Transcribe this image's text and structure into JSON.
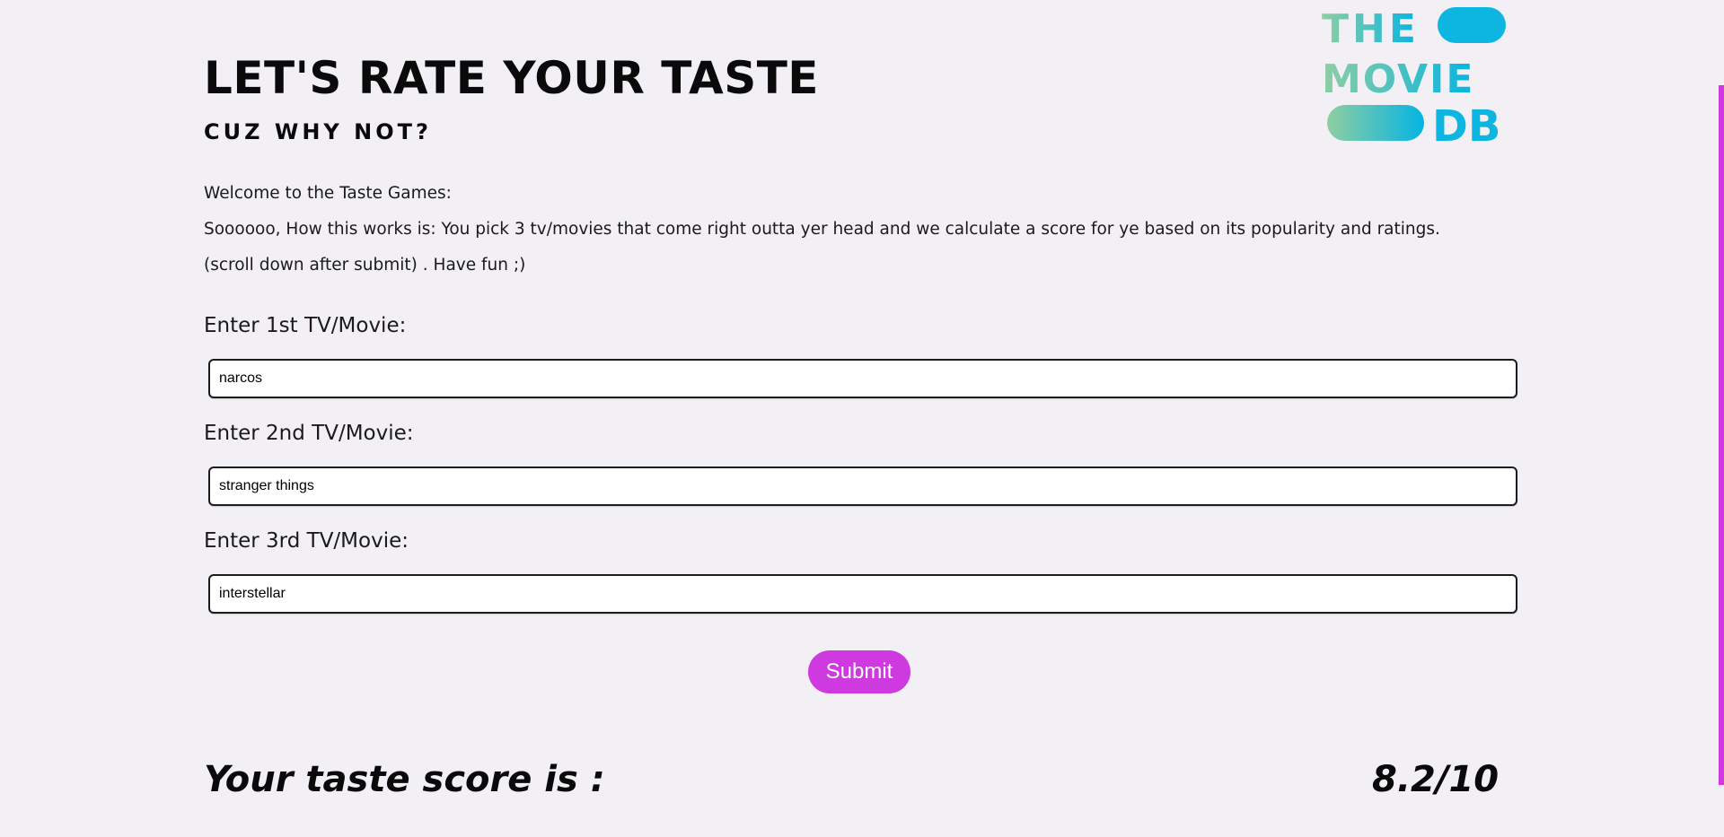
{
  "header": {
    "title": "LET'S RATE YOUR TASTE",
    "subtitle": "CUZ WHY NOT?"
  },
  "logo": {
    "line1": "THE",
    "line2": "MOVIE",
    "line3": "DB",
    "gradient_start": "#8fcea2",
    "gradient_end": "#05b4e3"
  },
  "intro": {
    "line1": "Welcome to the Taste Games:",
    "line2": "Soooooo, How this works is: You pick 3 tv/movies that come right outta yer head and we calculate a score for ye based on its popularity and ratings.",
    "line3": "(scroll down after submit) . Have fun ;)"
  },
  "form": {
    "fields": [
      {
        "label": "Enter 1st TV/Movie:",
        "value": "narcos"
      },
      {
        "label": "Enter 2nd TV/Movie:",
        "value": "stranger things"
      },
      {
        "label": "Enter 3rd TV/Movie:",
        "value": "interstellar"
      }
    ],
    "submit_label": "Submit"
  },
  "result": {
    "label": "Your taste score is :",
    "score": "8.2/10"
  },
  "colors": {
    "background": "#f2f0f5",
    "accent": "#cf3ae0"
  }
}
